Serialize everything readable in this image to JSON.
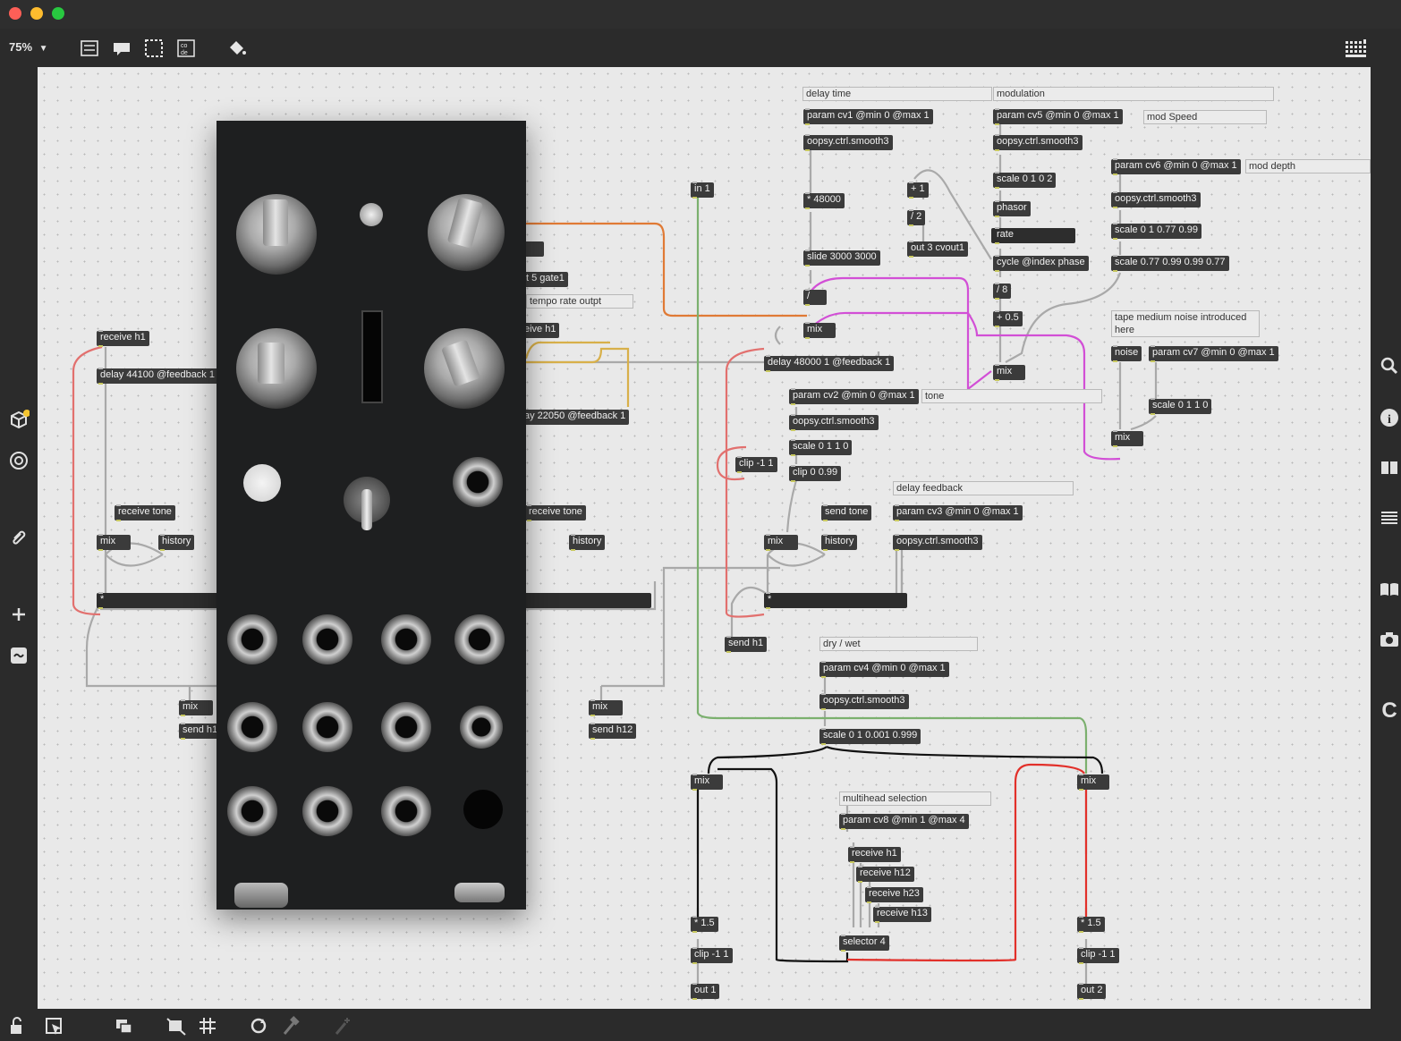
{
  "window": {
    "zoom": "75%"
  },
  "colors": {
    "wire_gray": "#a9a9a9",
    "wire_orange": "#e07a35",
    "wire_yellow": "#d8b04a",
    "wire_magenta": "#d24fd6",
    "wire_pink": "#e2706e",
    "wire_green": "#7bb06e",
    "wire_red": "#e2302a",
    "wire_black": "#111111"
  },
  "toolbar": {
    "zoom_label": "75%",
    "icons": [
      "presentation-icon",
      "comment-icon",
      "frame-icon",
      "code-icon",
      "paint-bucket-icon",
      "grid-patcher-icon"
    ]
  },
  "left_sidebar": {
    "icons": [
      "package-icon",
      "target-icon",
      "paperclip-icon",
      "plus-icon",
      "tilde-icon"
    ]
  },
  "right_sidebar": {
    "icons": [
      "search-icon",
      "info-icon",
      "split-view-icon",
      "list-icon",
      "book-icon",
      "camera-icon",
      "c-icon"
    ]
  },
  "bottom_toolbar": {
    "icons": [
      "lock-icon",
      "pointer-icon",
      "window-icon",
      "hide-icon",
      "grid-icon",
      "cycle-icon",
      "hammer-icon",
      "debug-icon"
    ]
  },
  "objects": {
    "receive_h1_left": "receive h1",
    "delay_44100": "delay 44100 @feedback 1",
    "receive_tone_left": "receive tone",
    "mix_left": "mix",
    "history_left": "history",
    "star_left": "*",
    "mix_left_bottom": "mix",
    "send_h1_left": "send h1",
    "in_partial": "in",
    "gate_partial": "t 5 gate1",
    "receive_partial": "eive h1",
    "delay_22050": "ay 22050 @feedback 1",
    "receive_tone_mid": "receive tone",
    "history_mid": "history",
    "mix_mid_bottom": "mix",
    "send_h12": "send h12",
    "in_1": "in 1",
    "param_cv1": "param cv1 @min 0 @max 1",
    "smooth_cv1": "oopsy.ctrl.smooth3",
    "mult_48000": "* 48000",
    "slide": "slide 3000 3000",
    "divide": "/",
    "mix_delay": "mix",
    "delay_48000": "delay 48000 1 @feedback 1",
    "param_cv2": "param cv2 @min 0 @max 1",
    "smooth_cv2": "oopsy.ctrl.smooth3",
    "scale_0110_a": "scale 0 1 1 0",
    "clip_099": "clip 0 0.99",
    "clip_neg1": "clip -1 1",
    "send_tone": "send tone",
    "mix_center": "mix",
    "history_center": "history",
    "star_center": "*",
    "send_h1_center": "send h1",
    "param_cv3": "param cv3 @min 0 @max 1",
    "smooth_cv3": "oopsy.ctrl.smooth3",
    "plus_1": "+ 1",
    "div_2": "/ 2",
    "out3": "out 3 cvout1",
    "param_cv5": "param cv5 @min 0 @max 1",
    "smooth_cv5": "oopsy.ctrl.smooth3",
    "scale_0102": "scale 0 1 0 2",
    "phasor": "phasor",
    "rate": "rate",
    "cycle": "cycle @index phase",
    "div_8": "/ 8",
    "plus_05": "+ 0.5",
    "mix_mod": "mix",
    "param_cv6": "param cv6 @min 0 @max 1",
    "smooth_cv6": "oopsy.ctrl.smooth3",
    "scale_077": "scale 0 1 0.77 0.99",
    "scale_077b": "scale 0.77 0.99 0.99 0.77",
    "noise": "noise",
    "param_cv7": "param cv7 @min 0 @max 1",
    "scale_0110_b": "scale 0 1 1 0",
    "mix_noise": "mix",
    "param_cv4": "param cv4 @min 0 @max 1",
    "smooth_cv4": "oopsy.ctrl.smooth3",
    "scale_dry": "scale 0 1 0.001 0.999",
    "mix_out1": "mix",
    "mix_out2": "mix",
    "param_cv8": "param cv8 @min 1 @max 4",
    "receive_h1_sel": "receive h1",
    "receive_h12": "receive h12",
    "receive_h23": "receive h23",
    "receive_h13": "receive h13",
    "selector": "selector 4",
    "mult_15_a": "* 1.5",
    "clip_a": "clip -1 1",
    "out1": "out 1",
    "mult_15_b": "* 1.5",
    "clip_b": "clip -1 1",
    "out2": "out 2"
  },
  "comments": {
    "delay_time": "delay time",
    "modulation": "modulation",
    "mod_speed": "mod Speed",
    "mod_depth": "mod depth",
    "tempo_rate": "tempo rate outpt",
    "tone": "tone",
    "tape_noise": "tape medium noise introduced here",
    "delay_feedback": "delay feedback",
    "dry_wet": "dry / wet",
    "multihead": "multihead selection"
  }
}
